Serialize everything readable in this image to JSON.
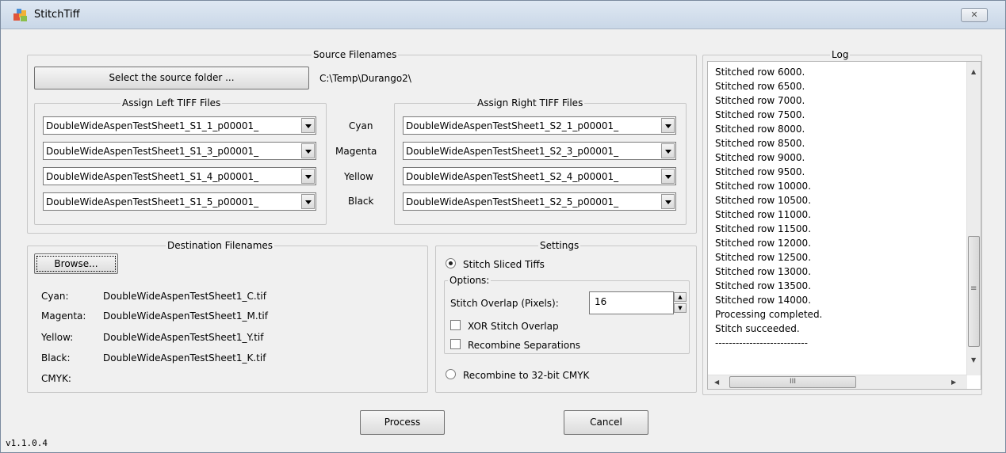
{
  "window": {
    "title": "StitchTiff",
    "close_glyph": "✕"
  },
  "source": {
    "group_title": "Source Filenames",
    "select_button": "Select the source folder ...",
    "folder_path": "C:\\Temp\\Durango2\\",
    "left_title": "Assign Left TIFF Files",
    "right_title": "Assign Right TIFF Files",
    "left_files": [
      "DoubleWideAspenTestSheet1_S1_1_p00001_",
      "DoubleWideAspenTestSheet1_S1_3_p00001_",
      "DoubleWideAspenTestSheet1_S1_4_p00001_",
      "DoubleWideAspenTestSheet1_S1_5_p00001_"
    ],
    "right_files": [
      "DoubleWideAspenTestSheet1_S2_1_p00001_",
      "DoubleWideAspenTestSheet1_S2_3_p00001_",
      "DoubleWideAspenTestSheet1_S2_4_p00001_",
      "DoubleWideAspenTestSheet1_S2_5_p00001_"
    ],
    "channels": [
      "Cyan",
      "Magenta",
      "Yellow",
      "Black"
    ]
  },
  "destination": {
    "group_title": "Destination Filenames",
    "browse_button": "Browse...",
    "rows": [
      {
        "label": "Cyan:",
        "file": "DoubleWideAspenTestSheet1_C.tif"
      },
      {
        "label": "Magenta:",
        "file": "DoubleWideAspenTestSheet1_M.tif"
      },
      {
        "label": "Yellow:",
        "file": "DoubleWideAspenTestSheet1_Y.tif"
      },
      {
        "label": "Black:",
        "file": "DoubleWideAspenTestSheet1_K.tif"
      },
      {
        "label": "CMYK:",
        "file": ""
      }
    ]
  },
  "settings": {
    "group_title": "Settings",
    "stitch_sliced": "Stitch Sliced Tiffs",
    "stitch_sliced_selected": true,
    "options_title": "Options:",
    "overlap_label": "Stitch Overlap (Pixels):",
    "overlap_value": "16",
    "xor_label": "XOR Stitch Overlap",
    "xor_checked": false,
    "recombine_sep_label": "Recombine Separations",
    "recombine_sep_checked": false,
    "recombine_cmyk": "Recombine to 32-bit CMYK",
    "recombine_cmyk_selected": false
  },
  "log": {
    "group_title": "Log",
    "lines": [
      "Stitched row 6000.",
      "Stitched row 6500.",
      "Stitched row 7000.",
      "Stitched row 7500.",
      "Stitched row 8000.",
      "Stitched row 8500.",
      "Stitched row 9000.",
      "Stitched row 9500.",
      "Stitched row 10000.",
      "Stitched row 10500.",
      "Stitched row 11000.",
      "Stitched row 11500.",
      "Stitched row 12000.",
      "Stitched row 12500.",
      "Stitched row 13000.",
      "Stitched row 13500.",
      "Stitched row 14000.",
      "Processing completed.",
      "Stitch succeeded.",
      "---------------------------"
    ],
    "hscroll_thumb_glyph": "III",
    "vscroll_thumb_glyph": "≡"
  },
  "footer": {
    "process_button": "Process",
    "cancel_button": "Cancel",
    "version": "v1.1.0.4"
  },
  "colors": {
    "window_bg": "#f0f0f0",
    "titlebar": "#c9d7e7"
  }
}
